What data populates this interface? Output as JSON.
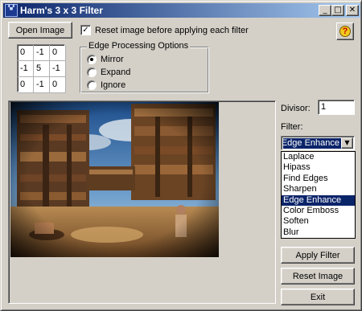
{
  "window": {
    "title": "Harm's 3 x 3 Filter",
    "icon_text": "HEL\nDOK"
  },
  "toolbar": {
    "open_label": "Open Image",
    "reset_checkbox_label": "Reset image before applying each filter",
    "reset_checked": true,
    "help_label": "?"
  },
  "kernel": {
    "cells": [
      [
        "0",
        "-1",
        "0"
      ],
      [
        "-1",
        "5",
        "-1"
      ],
      [
        "0",
        "-1",
        "0"
      ]
    ]
  },
  "edge": {
    "title": "Edge Processing Options",
    "options": [
      "Mirror",
      "Expand",
      "Ignore"
    ],
    "selected": "Mirror"
  },
  "divisor": {
    "label": "Divisor:",
    "value": "1"
  },
  "filter": {
    "label": "Filter:",
    "selected": "Edge Enhance",
    "options": [
      "Laplace",
      "Hipass",
      "Find Edges",
      "Sharpen",
      "Edge Enhance",
      "Color Emboss",
      "Soften",
      "Blur"
    ]
  },
  "actions": {
    "apply_label": "Apply Filter",
    "reset_label": "Reset Image",
    "exit_label": "Exit"
  },
  "colors": {
    "title_start": "#0a246a",
    "title_end": "#a6caf0",
    "face": "#d4d0c8",
    "selection": "#0a246a"
  }
}
